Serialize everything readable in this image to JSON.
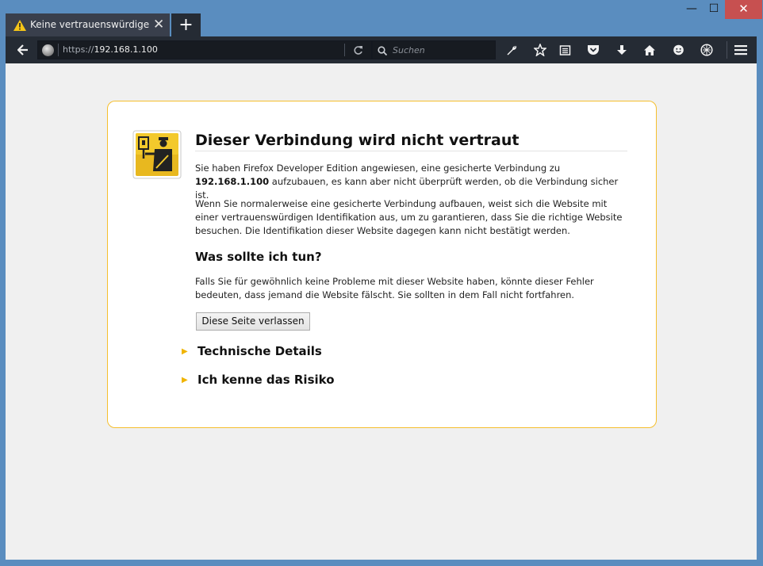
{
  "tab": {
    "title": "Keine vertrauenswürdige ...",
    "close": "✕"
  },
  "newtab": {
    "label": "+"
  },
  "window": {
    "min": "—",
    "max": "☐",
    "close": "✕"
  },
  "urlbar": {
    "scheme": "https://",
    "host": "192.168.1.100"
  },
  "search": {
    "placeholder": "Suchen"
  },
  "error": {
    "title": "Dieser Verbindung wird nicht vertraut",
    "p1_start": "Sie haben Firefox Developer Edition angewiesen, eine gesicherte Verbindung zu ",
    "p1_host": "192.168.1.100",
    "p1_end": " aufzubauen, es kann aber nicht überprüft werden, ob die Verbindung sicher ist.",
    "p2": "Wenn Sie normalerweise eine gesicherte Verbindung aufbauen, weist sich die Website mit einer vertrauenswürdigen Identifikation aus, um zu garantieren, dass Sie die richtige Website besuchen. Die Identifikation dieser Website dagegen kann nicht bestätigt werden.",
    "h2": "Was sollte ich tun?",
    "p3": "Falls Sie für gewöhnlich keine Probleme mit dieser Website haben, könnte dieser Fehler bedeuten, dass jemand die Website fälscht. Sie sollten in dem Fall nicht fortfahren.",
    "leave_button": "Diese Seite verlassen",
    "technical_details": "Technische Details",
    "understand_risk": "Ich kenne das Risiko"
  },
  "colors": {
    "accent": "#f5bf2e",
    "toolbar": "#252b34",
    "frame": "#5a8dbf"
  }
}
